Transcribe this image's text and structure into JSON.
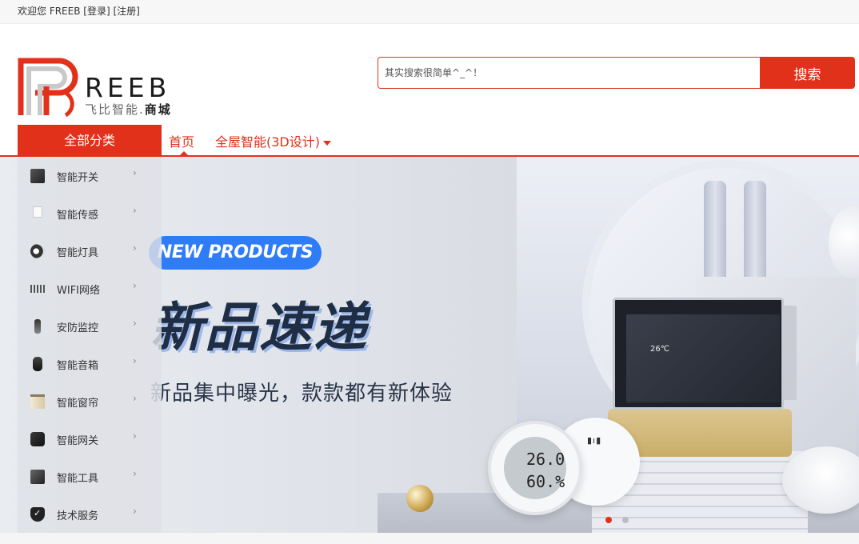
{
  "topbar": {
    "welcome": "欢迎您 FREEB",
    "login": "[登录]",
    "register": "[注册]"
  },
  "logo": {
    "brand": "REEB",
    "sub_prefix": "飞比智能.",
    "sub_bold": "商城"
  },
  "search": {
    "placeholder": "其实搜索很简单^_^！",
    "button_label": "搜索"
  },
  "nav": {
    "all_categories": "全部分类",
    "home": "首页",
    "whole_house": "全屋智能(3D设计)"
  },
  "sidebar": {
    "items": [
      {
        "label": "智能开关",
        "icon": "switch-icon"
      },
      {
        "label": "智能传感",
        "icon": "sensor-icon"
      },
      {
        "label": "智能灯具",
        "icon": "lamp-icon"
      },
      {
        "label": "WIFI网络",
        "icon": "wifi-router-icon"
      },
      {
        "label": "安防监控",
        "icon": "camera-icon"
      },
      {
        "label": "智能音箱",
        "icon": "speaker-icon"
      },
      {
        "label": "智能窗帘",
        "icon": "curtain-icon"
      },
      {
        "label": "智能网关",
        "icon": "gateway-icon"
      },
      {
        "label": "智能工具",
        "icon": "tool-icon"
      },
      {
        "label": "技术服务",
        "icon": "shield-check-icon"
      }
    ],
    "arrow": "›"
  },
  "banner": {
    "badge": "NEW PRODUCTS",
    "headline": "新品速递",
    "subline": "新品集中曝光，款款都有新体验",
    "sensor_temp": "26.0",
    "sensor_humidity": "60.%",
    "panel_temp": "26℃",
    "slide_count": 2,
    "active_slide": 1
  },
  "colors": {
    "accent": "#e2311a",
    "badge": "#2f7df6",
    "headline": "#1f2d45"
  }
}
